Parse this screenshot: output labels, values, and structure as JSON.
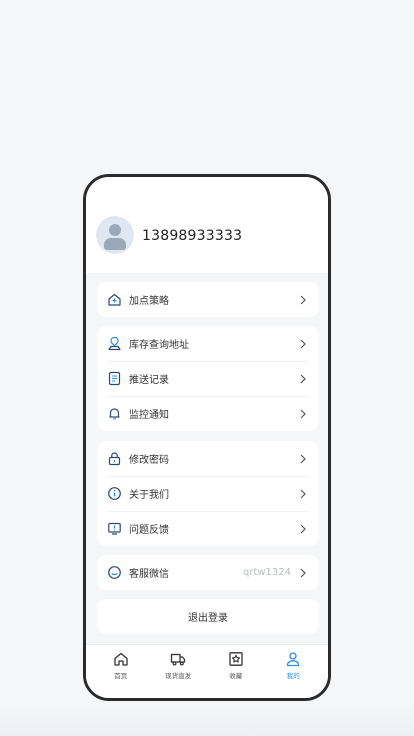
{
  "profile": {
    "phone": "13898933333"
  },
  "menu": {
    "group1": [
      {
        "label": "加点策略",
        "icon": "house-plus-icon"
      }
    ],
    "group2": [
      {
        "label": "库存查询地址",
        "icon": "location-pin-icon"
      },
      {
        "label": "推送记录",
        "icon": "document-list-icon"
      },
      {
        "label": "监控通知",
        "icon": "bell-icon"
      }
    ],
    "group3": [
      {
        "label": "修改密码",
        "icon": "lock-icon"
      },
      {
        "label": "关于我们",
        "icon": "info-icon"
      },
      {
        "label": "问题反馈",
        "icon": "feedback-icon"
      }
    ],
    "group4": [
      {
        "label": "客服微信",
        "value": "qrtw1324",
        "icon": "smile-icon"
      }
    ]
  },
  "logout_label": "退出登录",
  "tabbar": {
    "items": [
      {
        "label": "首页",
        "icon": "home-icon"
      },
      {
        "label": "现货直发",
        "icon": "truck-icon"
      },
      {
        "label": "收藏",
        "icon": "star-box-icon"
      },
      {
        "label": "我的",
        "icon": "user-icon"
      }
    ]
  },
  "colors": {
    "accent": "#2e8ee3",
    "icon_dark": "#2f4a6b",
    "background": "#f5f6f8"
  }
}
